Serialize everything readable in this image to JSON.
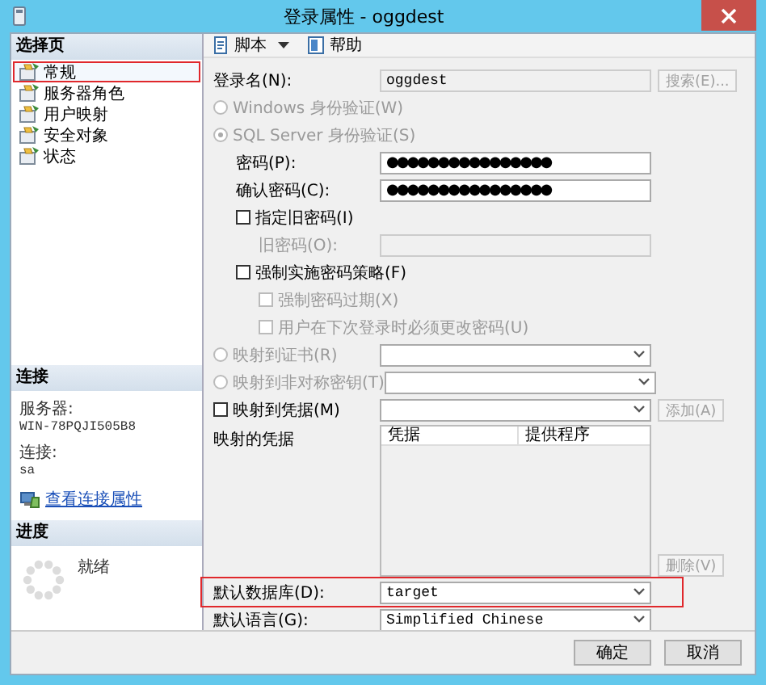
{
  "window": {
    "title": "登录属性 - oggdest"
  },
  "sidebar": {
    "header": "选择页",
    "items": [
      {
        "label": "常规",
        "selected": true,
        "highlighted": true
      },
      {
        "label": "服务器角色",
        "selected": false,
        "highlighted": false
      },
      {
        "label": "用户映射",
        "selected": false,
        "highlighted": false
      },
      {
        "label": "安全对象",
        "selected": false,
        "highlighted": false
      },
      {
        "label": "状态",
        "selected": false,
        "highlighted": false
      }
    ]
  },
  "connection": {
    "header": "连接",
    "server_label": "服务器:",
    "server": "WIN-78PQJI505B8",
    "login_label": "连接:",
    "login": "sa",
    "link": "查看连接属性"
  },
  "progress": {
    "header": "进度",
    "status": "就绪"
  },
  "toolbar": {
    "script": "脚本",
    "help": "帮助"
  },
  "form": {
    "rows": [
      {
        "kind": "field",
        "label": "登录名(N):",
        "disabled": false,
        "control": {
          "kind": "text",
          "value": "oggdest",
          "disabled": true
        },
        "button": {
          "label": "搜索(E)...",
          "disabled": true
        }
      },
      {
        "kind": "radio",
        "label": "Windows 身份验证(W)",
        "selected": false,
        "disabled": true
      },
      {
        "kind": "radio",
        "label": "SQL Server 身份验证(S)",
        "selected": true,
        "disabled": true,
        "children": [
          {
            "kind": "field",
            "label": "密码(P):",
            "disabled": false,
            "control": {
              "kind": "text",
              "value": "●●●●●●●●●●●●●●●●",
              "disabled": false
            }
          },
          {
            "kind": "field",
            "label": "确认密码(C):",
            "disabled": false,
            "control": {
              "kind": "text",
              "value": "●●●●●●●●●●●●●●●●",
              "disabled": false
            }
          },
          {
            "kind": "checkbox",
            "label": "指定旧密码(I)",
            "checked": false,
            "disabled": false,
            "children": [
              {
                "kind": "field",
                "label": "旧密码(O):",
                "disabled": true,
                "control": {
                  "kind": "text",
                  "disabled": true
                }
              }
            ]
          },
          {
            "kind": "checkbox",
            "label": "强制实施密码策略(F)",
            "checked": false,
            "disabled": false,
            "children": [
              {
                "kind": "checkbox",
                "label": "强制密码过期(X)",
                "checked": false,
                "disabled": true
              },
              {
                "kind": "checkbox",
                "label": "用户在下次登录时必须更改密码(U)",
                "checked": false,
                "disabled": true
              }
            ]
          }
        ]
      },
      {
        "kind": "radio",
        "label": "映射到证书(R)",
        "selected": false,
        "disabled": true,
        "control": {
          "kind": "combo",
          "disabled": false
        }
      },
      {
        "kind": "radio",
        "label": "映射到非对称密钥(T)",
        "selected": false,
        "disabled": true,
        "control": {
          "kind": "combo",
          "disabled": false
        }
      },
      {
        "kind": "checkbox",
        "label": "映射到凭据(M)",
        "checked": false,
        "disabled": false,
        "control": {
          "kind": "combo",
          "disabled": false
        },
        "button": {
          "label": "添加(A)",
          "disabled": true
        }
      },
      {
        "kind": "list",
        "label": "映射的凭据",
        "columns": [
          "凭据",
          "提供程序"
        ],
        "button": {
          "label": "删除(V)",
          "disabled": true
        }
      },
      {
        "kind": "field",
        "label": "默认数据库(D):",
        "disabled": false,
        "highlighted": true,
        "control": {
          "kind": "combo",
          "value": "target",
          "disabled": false
        }
      },
      {
        "kind": "field",
        "label": "默认语言(G):",
        "disabled": false,
        "control": {
          "kind": "combo",
          "value": "Simplified Chinese",
          "disabled": false
        }
      }
    ]
  },
  "buttons": [
    {
      "label": "确定",
      "disabled": false
    },
    {
      "label": "取消",
      "disabled": false
    }
  ]
}
